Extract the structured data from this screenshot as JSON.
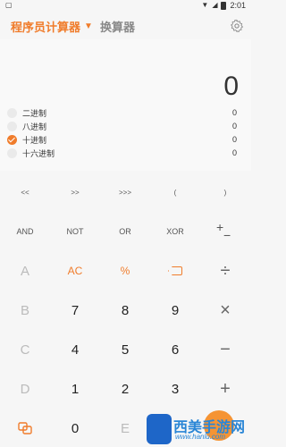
{
  "statusbar": {
    "left_icon": "notification-icon",
    "time": "2:01"
  },
  "header": {
    "active_tab": "程序员计算器",
    "other_tab": "换算器"
  },
  "display": {
    "result": "0",
    "bases": [
      {
        "label": "二进制",
        "value": "0",
        "selected": false
      },
      {
        "label": "八进制",
        "value": "0",
        "selected": false
      },
      {
        "label": "十进制",
        "value": "0",
        "selected": true
      },
      {
        "label": "十六进制",
        "value": "0",
        "selected": false
      }
    ]
  },
  "keypad": {
    "shift_keys": [
      "<<",
      ">>",
      ">>>",
      "(",
      ")"
    ],
    "logic_keys": [
      "AND",
      "NOT",
      "OR",
      "XOR"
    ],
    "row_a": {
      "hex": "A",
      "clear": "AC",
      "percent": "%",
      "divide": "÷"
    },
    "row_b": {
      "hex": "B",
      "d1": "7",
      "d2": "8",
      "d3": "9",
      "op": "×"
    },
    "row_c": {
      "hex": "C",
      "d1": "4",
      "d2": "5",
      "d3": "6",
      "op": "−"
    },
    "row_d": {
      "hex": "D",
      "d1": "1",
      "d2": "2",
      "d3": "3",
      "op": "+"
    },
    "row_e": {
      "d1": "0",
      "hex": "E"
    }
  },
  "watermark": {
    "text": "西美手游网",
    "url": "www.hanlu.com"
  },
  "colors": {
    "accent": "#f07c2b",
    "muted": "#bbbbbb"
  }
}
